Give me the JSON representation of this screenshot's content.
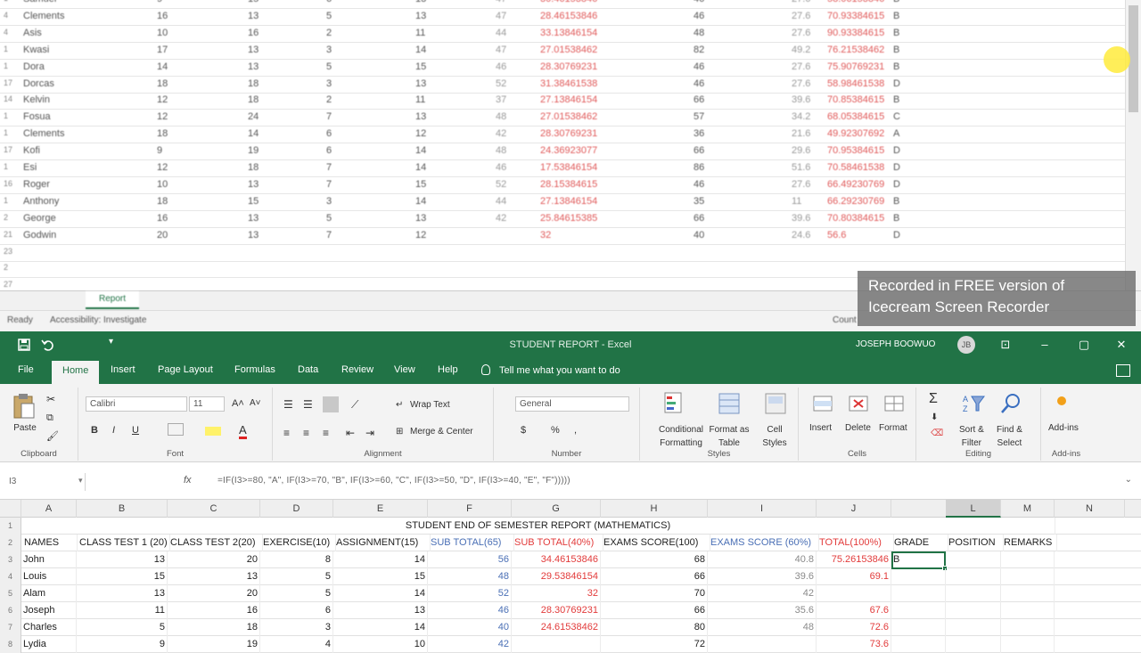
{
  "bg_window": {
    "rows": [
      {
        "n": "1",
        "name": "Samuel",
        "a": "9",
        "b": "15",
        "c": "6",
        "d": "13",
        "e": "47",
        "f": "30.46153846",
        "g": "46",
        "h": "27.6",
        "i": "58.06153846",
        "j": "B"
      },
      {
        "n": "4",
        "name": "Clements",
        "a": "16",
        "b": "13",
        "c": "5",
        "d": "13",
        "e": "47",
        "f": "28.46153846",
        "g": "46",
        "h": "27.6",
        "i": "70.93384615",
        "j": "B"
      },
      {
        "n": "4",
        "name": "Asis",
        "a": "10",
        "b": "16",
        "c": "2",
        "d": "11",
        "e": "44",
        "f": "33.13846154",
        "g": "48",
        "h": "27.6",
        "i": "90.93384615",
        "j": "B"
      },
      {
        "n": "1",
        "name": "Kwasi",
        "a": "17",
        "b": "13",
        "c": "3",
        "d": "14",
        "e": "47",
        "f": "27.01538462",
        "g": "82",
        "h": "49.2",
        "i": "76.21538462",
        "j": "B"
      },
      {
        "n": "1",
        "name": "Dora",
        "a": "14",
        "b": "13",
        "c": "5",
        "d": "15",
        "e": "46",
        "f": "28.30769231",
        "g": "46",
        "h": "27.6",
        "i": "75.90769231",
        "j": "B"
      },
      {
        "n": "17",
        "name": "Dorcas",
        "a": "18",
        "b": "18",
        "c": "3",
        "d": "13",
        "e": "52",
        "f": "31.38461538",
        "g": "46",
        "h": "27.6",
        "i": "58.98461538",
        "j": "D"
      },
      {
        "n": "14",
        "name": "Kelvin",
        "a": "12",
        "b": "18",
        "c": "2",
        "d": "11",
        "e": "37",
        "f": "27.13846154",
        "g": "66",
        "h": "39.6",
        "i": "70.85384615",
        "j": "B"
      },
      {
        "n": "1",
        "name": "Fosua",
        "a": "12",
        "b": "24",
        "c": "7",
        "d": "13",
        "e": "48",
        "f": "27.01538462",
        "g": "57",
        "h": "34.2",
        "i": "68.05384615",
        "j": "C"
      },
      {
        "n": "1",
        "name": "Clements",
        "a": "18",
        "b": "14",
        "c": "6",
        "d": "12",
        "e": "42",
        "f": "28.30769231",
        "g": "36",
        "h": "21.6",
        "i": "49.92307692",
        "j": "A"
      },
      {
        "n": "17",
        "name": "Kofi",
        "a": "9",
        "b": "19",
        "c": "6",
        "d": "14",
        "e": "48",
        "f": "24.36923077",
        "g": "66",
        "h": "29.6",
        "i": "70.95384615",
        "j": "D"
      },
      {
        "n": "1",
        "name": "Esi",
        "a": "12",
        "b": "18",
        "c": "7",
        "d": "14",
        "e": "46",
        "f": "17.53846154",
        "g": "86",
        "h": "51.6",
        "i": "70.58461538",
        "j": "D"
      },
      {
        "n": "16",
        "name": "Roger",
        "a": "10",
        "b": "13",
        "c": "7",
        "d": "15",
        "e": "52",
        "f": "28.15384615",
        "g": "46",
        "h": "27.6",
        "i": "66.49230769",
        "j": "D"
      },
      {
        "n": "1",
        "name": "Anthony",
        "a": "18",
        "b": "15",
        "c": "3",
        "d": "14",
        "e": "44",
        "f": "27.13846154",
        "g": "35",
        "h": "11",
        "i": "66.29230769",
        "j": "B"
      },
      {
        "n": "2",
        "name": "George",
        "a": "16",
        "b": "13",
        "c": "5",
        "d": "13",
        "e": "42",
        "f": "25.84615385",
        "g": "66",
        "h": "39.6",
        "i": "70.80384615",
        "j": "B"
      },
      {
        "n": "21",
        "name": "Godwin",
        "a": "20",
        "b": "13",
        "c": "7",
        "d": "12",
        "e": "",
        "f": "32",
        "g": "40",
        "h": "24.6",
        "i": "56.6",
        "j": "D"
      },
      {
        "n": "23",
        "name": "",
        "a": "",
        "b": "",
        "c": "",
        "d": "",
        "e": "",
        "f": "",
        "g": "",
        "h": "",
        "i": "",
        "j": ""
      },
      {
        "n": "2",
        "name": "",
        "a": "",
        "b": "",
        "c": "",
        "d": "",
        "e": "",
        "f": "",
        "g": "",
        "h": "",
        "i": "",
        "j": ""
      },
      {
        "n": "27",
        "name": "",
        "a": "",
        "b": "",
        "c": "",
        "d": "",
        "e": "",
        "f": "",
        "g": "",
        "h": "",
        "i": "",
        "j": ""
      }
    ],
    "sheet_tab": "Report",
    "status_ready": "Ready",
    "status_accessibility": "Accessibility: Investigate",
    "status_count": "Count"
  },
  "watermark": {
    "line1": "Recorded in FREE version of",
    "line2": "Icecream   Screen   Recorder"
  },
  "titlebar": {
    "doc_title": "STUDENT REPORT - Excel",
    "user_name": "JOSEPH BOOWUO",
    "user_initials": "JB",
    "save_icon": "save-icon",
    "undo_icon": "undo-icon",
    "min_glyph": "–",
    "max_glyph": "▢",
    "close_glyph": "✕",
    "ribbon_opts_glyph": "⊡"
  },
  "menu": {
    "file": "File",
    "home": "Home",
    "insert": "Insert",
    "page_layout": "Page Layout",
    "formulas": "Formulas",
    "data": "Data",
    "review": "Review",
    "view": "View",
    "help": "Help",
    "tellme": "Tell me what you want to do"
  },
  "ribbon": {
    "clipboard": {
      "paste": "Paste",
      "label": "Clipboard"
    },
    "font": {
      "name": "Calibri",
      "size": "11",
      "bold": "B",
      "italic": "I",
      "underline": "U",
      "label": "Font"
    },
    "alignment": {
      "wrap_text": "Wrap Text",
      "merge_center": "Merge & Center",
      "label": "Alignment"
    },
    "number": {
      "format": "General",
      "percent": "%",
      "comma": ",",
      "label": "Number"
    },
    "styles": {
      "conditional": "Conditional",
      "conditional2": "Formatting",
      "format_as": "Format as",
      "table": "Table",
      "cell": "Cell",
      "styles_btn": "Styles",
      "label": "Styles"
    },
    "cells": {
      "insert": "Insert",
      "delete": "Delete",
      "format": "Format",
      "label": "Cells"
    },
    "editing": {
      "sort": "Sort &",
      "filter": "Filter",
      "find": "Find &",
      "select": "Select",
      "label": "Editing"
    },
    "addins": {
      "btn": "Add-ins",
      "label": "Add-ins"
    }
  },
  "formula_bar": {
    "name_box": "I3",
    "fx": "fx",
    "formula": "=IF(I3>=80, \"A\", IF(I3>=70, \"B\", IF(I3>=60, \"C\", IF(I3>=50, \"D\", IF(I3>=40, \"E\", \"F\")))))"
  },
  "grid": {
    "columns": [
      "A",
      "B",
      "C",
      "D",
      "E",
      "F",
      "G",
      "H",
      "I",
      "J",
      "L",
      "M",
      "N"
    ],
    "title_row": "STUDENT END OF SEMESTER REPORT (MATHEMATICS)",
    "headers": [
      "NAMES",
      "CLASS TEST 1 (20)",
      "CLASS TEST 2(20)",
      "EXERCISE(10)",
      "ASSIGNMENT(15)",
      "SUB TOTAL(65)",
      "SUB TOTAL(40%)",
      "EXAMS SCORE(100)",
      "EXAMS SCORE (60%)",
      "TOTAL(100%)",
      "GRADE",
      "POSITION",
      "REMARKS"
    ],
    "rows": [
      {
        "n": "3",
        "name": "John",
        "ct1": "13",
        "ct2": "20",
        "ex": "8",
        "as": "14",
        "st": "56",
        "st40": "34.46153846",
        "es": "68",
        "es60": "40.8",
        "tot": "75.26153846",
        "grade": "B"
      },
      {
        "n": "4",
        "name": "Louis",
        "ct1": "15",
        "ct2": "13",
        "ex": "5",
        "as": "15",
        "st": "48",
        "st40": "29.53846154",
        "es": "66",
        "es60": "39.6",
        "tot": "69.1",
        "grade": ""
      },
      {
        "n": "5",
        "name": "Alam",
        "ct1": "13",
        "ct2": "20",
        "ex": "5",
        "as": "14",
        "st": "52",
        "st40": "32",
        "es": "70",
        "es60": "42",
        "tot": "",
        "grade": ""
      },
      {
        "n": "6",
        "name": "Joseph",
        "ct1": "11",
        "ct2": "16",
        "ex": "6",
        "as": "13",
        "st": "46",
        "st40": "28.30769231",
        "es": "66",
        "es60": "35.6",
        "tot": "67.6",
        "grade": ""
      },
      {
        "n": "7",
        "name": "Charles",
        "ct1": "5",
        "ct2": "18",
        "ex": "3",
        "as": "14",
        "st": "40",
        "st40": "24.61538462",
        "es": "80",
        "es60": "48",
        "tot": "72.6",
        "grade": ""
      },
      {
        "n": "8",
        "name": "Lydia",
        "ct1": "9",
        "ct2": "19",
        "ex": "4",
        "as": "10",
        "st": "42",
        "st40": "",
        "es": "72",
        "es60": "",
        "tot": "73.6",
        "grade": ""
      }
    ]
  }
}
